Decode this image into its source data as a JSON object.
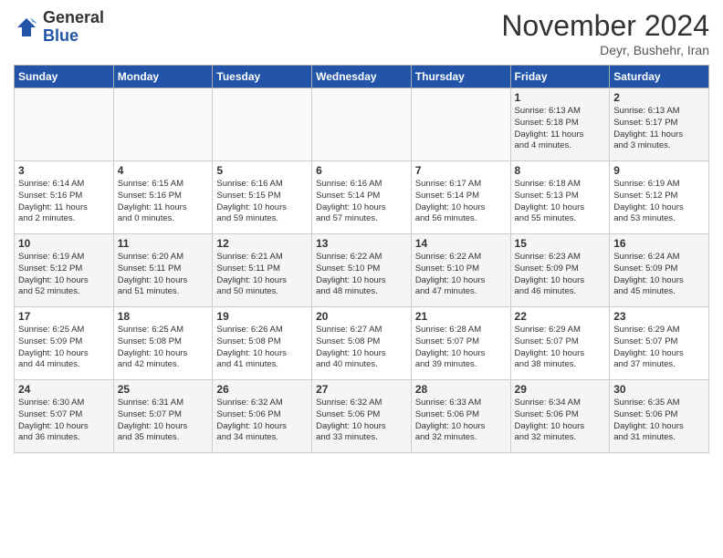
{
  "header": {
    "logo_general": "General",
    "logo_blue": "Blue",
    "month": "November 2024",
    "location": "Deyr, Bushehr, Iran"
  },
  "days_of_week": [
    "Sunday",
    "Monday",
    "Tuesday",
    "Wednesday",
    "Thursday",
    "Friday",
    "Saturday"
  ],
  "weeks": [
    [
      {
        "day": "",
        "text": ""
      },
      {
        "day": "",
        "text": ""
      },
      {
        "day": "",
        "text": ""
      },
      {
        "day": "",
        "text": ""
      },
      {
        "day": "",
        "text": ""
      },
      {
        "day": "1",
        "text": "Sunrise: 6:13 AM\nSunset: 5:18 PM\nDaylight: 11 hours\nand 4 minutes."
      },
      {
        "day": "2",
        "text": "Sunrise: 6:13 AM\nSunset: 5:17 PM\nDaylight: 11 hours\nand 3 minutes."
      }
    ],
    [
      {
        "day": "3",
        "text": "Sunrise: 6:14 AM\nSunset: 5:16 PM\nDaylight: 11 hours\nand 2 minutes."
      },
      {
        "day": "4",
        "text": "Sunrise: 6:15 AM\nSunset: 5:16 PM\nDaylight: 11 hours\nand 0 minutes."
      },
      {
        "day": "5",
        "text": "Sunrise: 6:16 AM\nSunset: 5:15 PM\nDaylight: 10 hours\nand 59 minutes."
      },
      {
        "day": "6",
        "text": "Sunrise: 6:16 AM\nSunset: 5:14 PM\nDaylight: 10 hours\nand 57 minutes."
      },
      {
        "day": "7",
        "text": "Sunrise: 6:17 AM\nSunset: 5:14 PM\nDaylight: 10 hours\nand 56 minutes."
      },
      {
        "day": "8",
        "text": "Sunrise: 6:18 AM\nSunset: 5:13 PM\nDaylight: 10 hours\nand 55 minutes."
      },
      {
        "day": "9",
        "text": "Sunrise: 6:19 AM\nSunset: 5:12 PM\nDaylight: 10 hours\nand 53 minutes."
      }
    ],
    [
      {
        "day": "10",
        "text": "Sunrise: 6:19 AM\nSunset: 5:12 PM\nDaylight: 10 hours\nand 52 minutes."
      },
      {
        "day": "11",
        "text": "Sunrise: 6:20 AM\nSunset: 5:11 PM\nDaylight: 10 hours\nand 51 minutes."
      },
      {
        "day": "12",
        "text": "Sunrise: 6:21 AM\nSunset: 5:11 PM\nDaylight: 10 hours\nand 50 minutes."
      },
      {
        "day": "13",
        "text": "Sunrise: 6:22 AM\nSunset: 5:10 PM\nDaylight: 10 hours\nand 48 minutes."
      },
      {
        "day": "14",
        "text": "Sunrise: 6:22 AM\nSunset: 5:10 PM\nDaylight: 10 hours\nand 47 minutes."
      },
      {
        "day": "15",
        "text": "Sunrise: 6:23 AM\nSunset: 5:09 PM\nDaylight: 10 hours\nand 46 minutes."
      },
      {
        "day": "16",
        "text": "Sunrise: 6:24 AM\nSunset: 5:09 PM\nDaylight: 10 hours\nand 45 minutes."
      }
    ],
    [
      {
        "day": "17",
        "text": "Sunrise: 6:25 AM\nSunset: 5:09 PM\nDaylight: 10 hours\nand 44 minutes."
      },
      {
        "day": "18",
        "text": "Sunrise: 6:25 AM\nSunset: 5:08 PM\nDaylight: 10 hours\nand 42 minutes."
      },
      {
        "day": "19",
        "text": "Sunrise: 6:26 AM\nSunset: 5:08 PM\nDaylight: 10 hours\nand 41 minutes."
      },
      {
        "day": "20",
        "text": "Sunrise: 6:27 AM\nSunset: 5:08 PM\nDaylight: 10 hours\nand 40 minutes."
      },
      {
        "day": "21",
        "text": "Sunrise: 6:28 AM\nSunset: 5:07 PM\nDaylight: 10 hours\nand 39 minutes."
      },
      {
        "day": "22",
        "text": "Sunrise: 6:29 AM\nSunset: 5:07 PM\nDaylight: 10 hours\nand 38 minutes."
      },
      {
        "day": "23",
        "text": "Sunrise: 6:29 AM\nSunset: 5:07 PM\nDaylight: 10 hours\nand 37 minutes."
      }
    ],
    [
      {
        "day": "24",
        "text": "Sunrise: 6:30 AM\nSunset: 5:07 PM\nDaylight: 10 hours\nand 36 minutes."
      },
      {
        "day": "25",
        "text": "Sunrise: 6:31 AM\nSunset: 5:07 PM\nDaylight: 10 hours\nand 35 minutes."
      },
      {
        "day": "26",
        "text": "Sunrise: 6:32 AM\nSunset: 5:06 PM\nDaylight: 10 hours\nand 34 minutes."
      },
      {
        "day": "27",
        "text": "Sunrise: 6:32 AM\nSunset: 5:06 PM\nDaylight: 10 hours\nand 33 minutes."
      },
      {
        "day": "28",
        "text": "Sunrise: 6:33 AM\nSunset: 5:06 PM\nDaylight: 10 hours\nand 32 minutes."
      },
      {
        "day": "29",
        "text": "Sunrise: 6:34 AM\nSunset: 5:06 PM\nDaylight: 10 hours\nand 32 minutes."
      },
      {
        "day": "30",
        "text": "Sunrise: 6:35 AM\nSunset: 5:06 PM\nDaylight: 10 hours\nand 31 minutes."
      }
    ]
  ]
}
